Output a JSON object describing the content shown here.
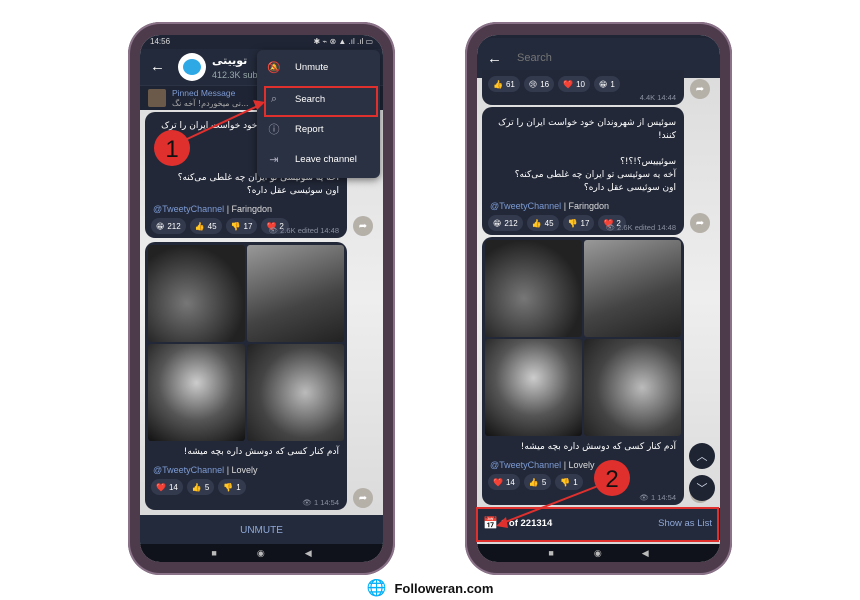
{
  "left_phone": {
    "status": {
      "time": "14:56",
      "icons": "✱ ⌁ ⊗ ▲ .ıl .ıl ▭"
    },
    "header": {
      "channel_name": "توییتی",
      "subscribers": "412.3K subscribers"
    },
    "pinned": {
      "label": "Pinned Message",
      "preview": "...نی میخوردم! آخه نگ"
    },
    "menu": [
      {
        "icon": "bell-off-icon",
        "label": "Unmute"
      },
      {
        "icon": "search-icon",
        "label": "Search"
      },
      {
        "icon": "report-icon",
        "label": "Report"
      },
      {
        "icon": "leave-icon",
        "label": "Leave channel"
      }
    ],
    "messages": [
      {
        "lines": [
          "سوئیس از شهروندان خود خواست ایران را ترک کنند!",
          "",
          "سوئیییس؟!؟!؟",
          "آخه یه سوئیسی تو ایران چه غلطی می‌کنه؟",
          "اون سوئیسی عقل داره؟"
        ],
        "handle": "@TweetyChannel",
        "tag": "Faringdon",
        "reactions": [
          {
            "emoji": "😁",
            "count": "212"
          },
          {
            "emoji": "👍",
            "count": "45"
          },
          {
            "emoji": "👎",
            "count": "17"
          },
          {
            "emoji": "❤️",
            "count": "2"
          }
        ],
        "views": "2.6K",
        "time": "edited 14:48"
      },
      {
        "lines": [
          "آدم کنار کسی که دوسش داره بچه میشه!"
        ],
        "handle": "@TweetyChannel",
        "tag": "Lovely",
        "reactions": [
          {
            "emoji": "❤️",
            "count": "14"
          },
          {
            "emoji": "👍",
            "count": "5"
          },
          {
            "emoji": "👎",
            "count": "1"
          }
        ],
        "views": "1",
        "time": "14:54"
      }
    ],
    "bottom_button": "UNMUTE"
  },
  "right_phone": {
    "search_placeholder": "Search",
    "prev_message": {
      "reactions": [
        {
          "emoji": "👍",
          "count": "61"
        },
        {
          "emoji": "😢",
          "count": "16"
        },
        {
          "emoji": "❤️",
          "count": "10"
        },
        {
          "emoji": "😁",
          "count": "1"
        }
      ],
      "views": "4.4K",
      "time": "14:44"
    },
    "messages": [
      {
        "lines": [
          "سوئیس از شهروندان خود خواست ایران را ترک کنند!",
          "",
          "سوئیییس؟!؟!؟",
          "آخه یه سوئیسی تو ایران چه غلطی می‌کنه؟",
          "اون سوئیسی عقل داره؟"
        ],
        "handle": "@TweetyChannel",
        "tag": "Faringdon",
        "reactions": [
          {
            "emoji": "😁",
            "count": "212"
          },
          {
            "emoji": "👍",
            "count": "45"
          },
          {
            "emoji": "👎",
            "count": "17"
          },
          {
            "emoji": "❤️",
            "count": "2"
          }
        ],
        "views": "2.6K",
        "time": "edited 14:48"
      },
      {
        "lines": [
          "آدم کنار کسی که دوسش داره بچه میشه!"
        ],
        "handle": "@TweetyChannel",
        "tag": "Lovely",
        "reactions": [
          {
            "emoji": "❤️",
            "count": "14"
          },
          {
            "emoji": "👍",
            "count": "5"
          },
          {
            "emoji": "👎",
            "count": "1"
          }
        ],
        "views": "1",
        "time": "14:54"
      }
    ],
    "search_bar": {
      "result_counter": "1 of 221314",
      "show_as_list": "Show as List"
    }
  },
  "annotations": {
    "step1": "1",
    "step2": "2",
    "color": "#e0302e"
  },
  "footer": {
    "brand": "Followeran.com"
  },
  "colors": {
    "header": "#232a3b",
    "bubble": "#222838",
    "link": "#7d9bd4",
    "accent_text": "#8fa8d8"
  }
}
